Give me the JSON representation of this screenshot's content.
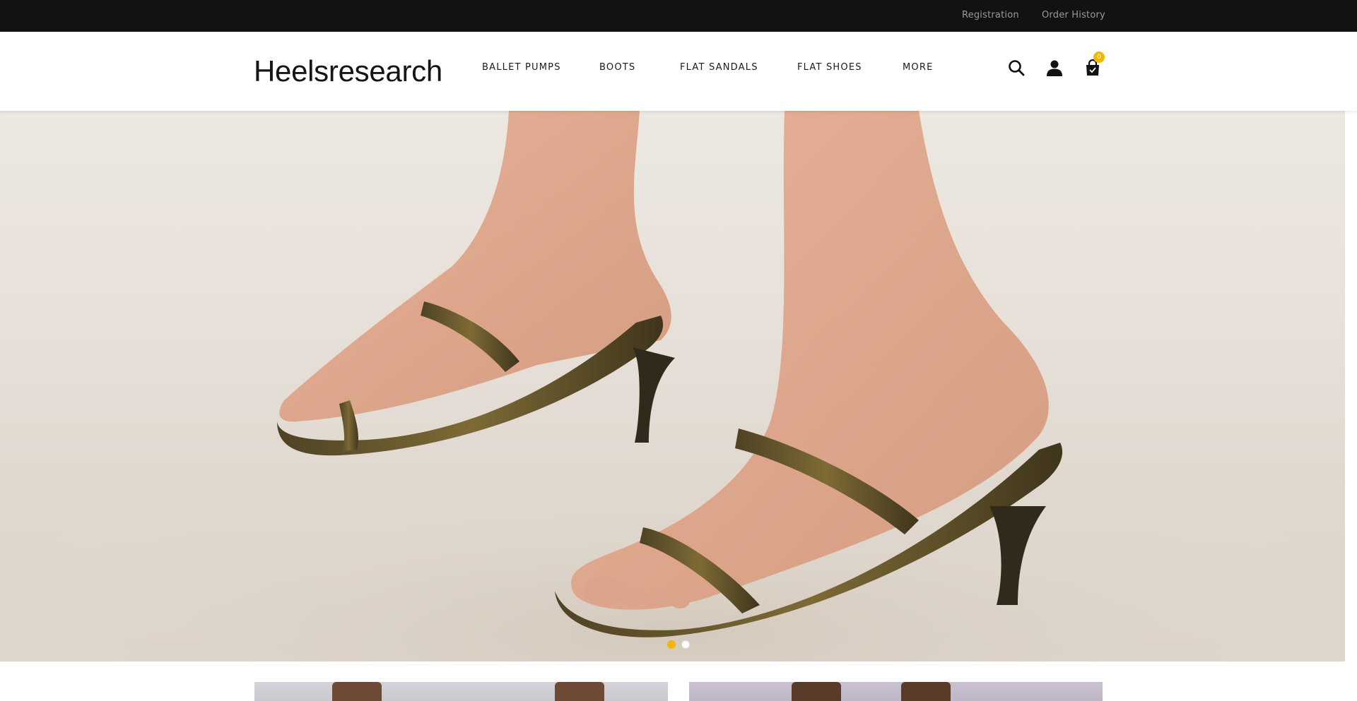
{
  "topbar": {
    "registration": "Registration",
    "order_history": "Order History"
  },
  "header": {
    "logo": "Heelsresearch",
    "nav": [
      "BALLET PUMPS",
      "BOOTS",
      "FLAT SANDALS",
      "FLAT SHOES",
      "MORE"
    ],
    "icons": [
      "search-icon",
      "account-icon",
      "shopping-bag-icon"
    ],
    "cart_count": "0"
  },
  "hero": {
    "image": "model wearing bronze snake-texture strappy mule heels",
    "slides": 2,
    "active_slide": 1
  },
  "colors": {
    "topbar": "#121212",
    "accent": "#f2b705",
    "text": "#1a1a1a"
  }
}
